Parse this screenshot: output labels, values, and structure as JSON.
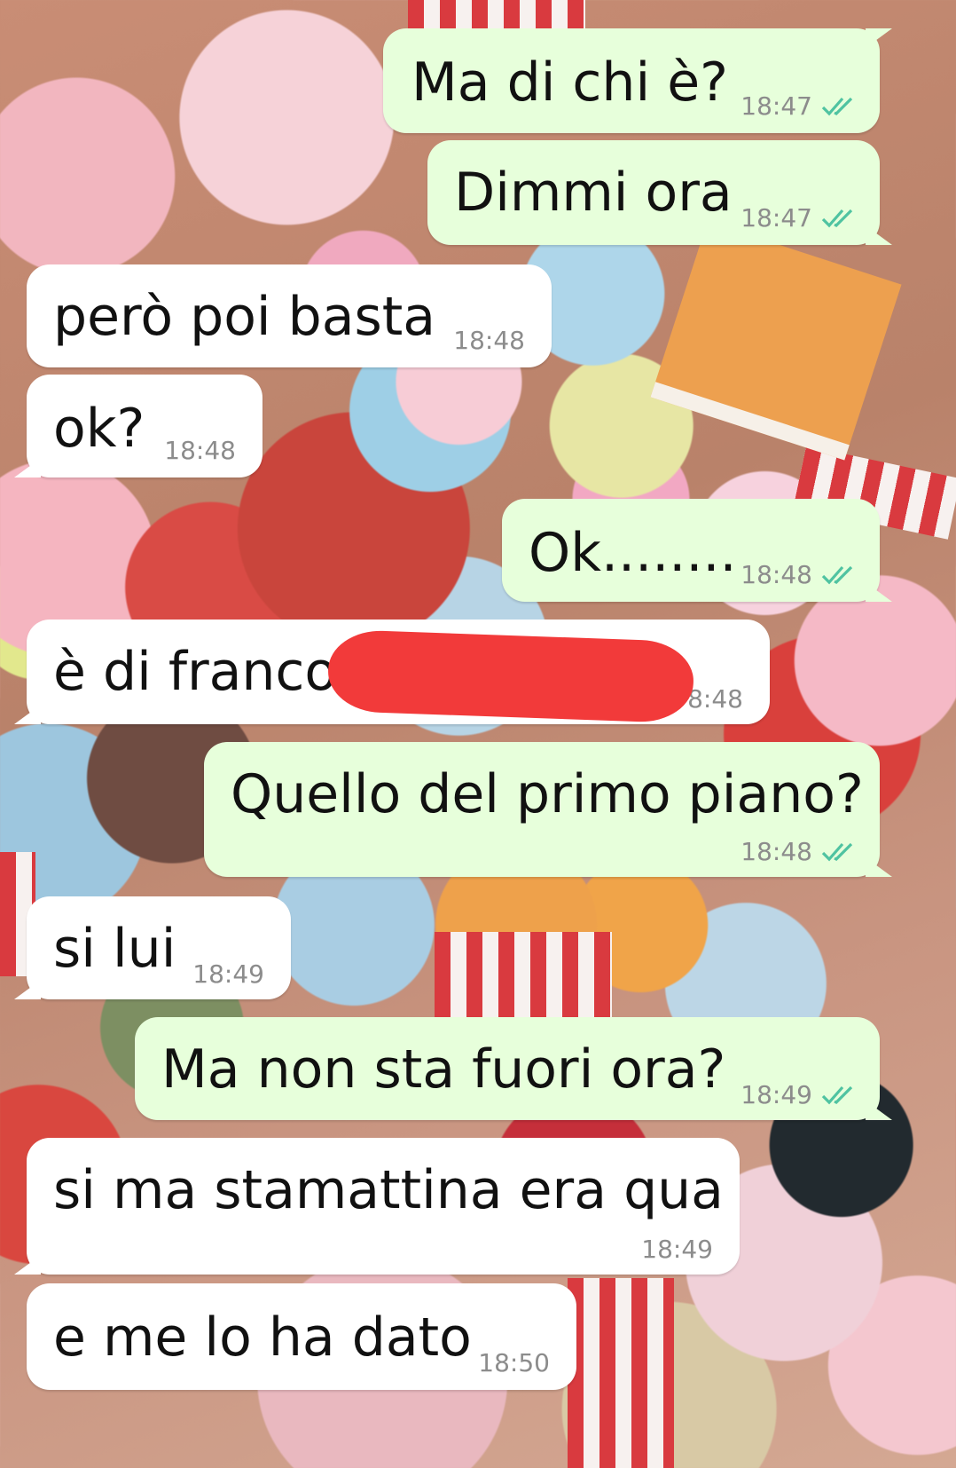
{
  "messages": [
    {
      "text": "Ma di chi è?",
      "time": "18:47",
      "sender": "me",
      "read_receipt": "double-check"
    },
    {
      "text": "Dimmi ora",
      "time": "18:47",
      "sender": "me",
      "read_receipt": "double-check"
    },
    {
      "text": "però poi basta",
      "time": "18:48",
      "sender": "contact"
    },
    {
      "text": "ok?",
      "time": "18:48",
      "sender": "contact"
    },
    {
      "text": "Ok........",
      "time": "18:48",
      "sender": "me",
      "read_receipt": "double-check"
    },
    {
      "text": "è di franco",
      "time": "8:48",
      "sender": "contact",
      "redacted": true
    },
    {
      "text": "Quello del primo piano?",
      "time": "18:48",
      "sender": "me",
      "read_receipt": "double-check"
    },
    {
      "text": "si lui",
      "time": "18:49",
      "sender": "contact"
    },
    {
      "text": "Ma non sta fuori ora?",
      "time": "18:49",
      "sender": "me",
      "read_receipt": "double-check"
    },
    {
      "text": "si ma stamattina era qua",
      "time": "18:49",
      "sender": "contact"
    },
    {
      "text": "e me lo ha dato",
      "time": "18:50",
      "sender": "contact"
    }
  ],
  "colors": {
    "outgoing_bubble": "#e7ffdb",
    "incoming_bubble": "#ffffff",
    "timestamp": "#8c8c8c",
    "read_check": "#4fc3a1",
    "redaction": "#f23a3a"
  },
  "wallpaper": "candy-photo"
}
